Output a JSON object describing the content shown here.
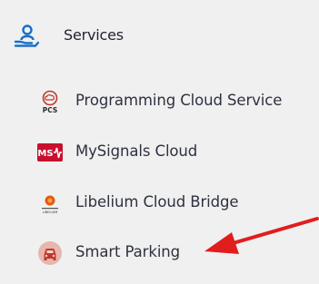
{
  "section": {
    "label": "Services",
    "icon": "services-hand-user-icon",
    "accent_color": "#1a6fc4"
  },
  "items": [
    {
      "label": "Programming Cloud Service",
      "icon": "pcs-cloud-icon",
      "icon_text": "PCS"
    },
    {
      "label": "MySignals Cloud",
      "icon": "mysignals-logo-icon",
      "icon_text": "MS"
    },
    {
      "label": "Libelium Cloud Bridge",
      "icon": "libelium-logo-icon",
      "icon_text": "LIBELIUM"
    },
    {
      "label": "Smart Parking",
      "icon": "car-icon"
    }
  ],
  "annotation": {
    "icon": "red-arrow-pointer",
    "color": "#e01e1e"
  }
}
